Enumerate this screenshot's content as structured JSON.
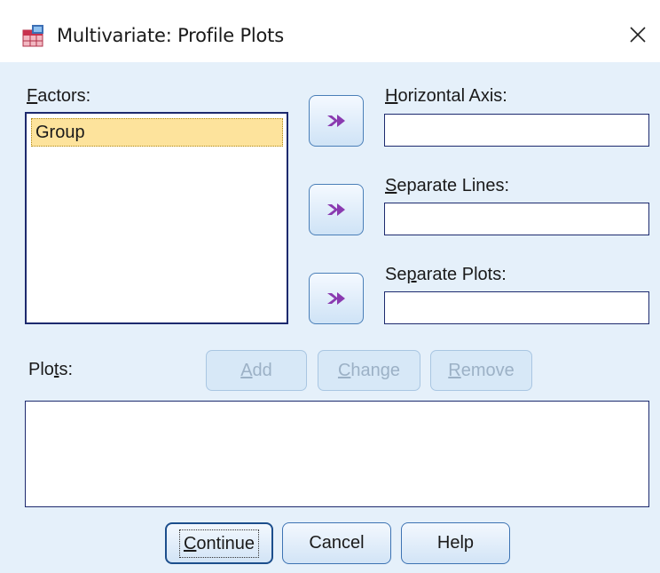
{
  "window": {
    "title": "Multivariate: Profile Plots",
    "app_icon": "spss-dialog-icon",
    "close_icon": "close-icon"
  },
  "factors": {
    "label_mnemonic": "F",
    "label_rest": "actors:",
    "items": [
      "Group"
    ],
    "selected_index": 0
  },
  "move_buttons": {
    "icon": "right-arrow-icon"
  },
  "horizontal_axis": {
    "label_mnemonic": "H",
    "label_rest": "orizontal Axis:",
    "value": ""
  },
  "separate_lines": {
    "label_mnemonic": "S",
    "label_rest": "eparate Lines:",
    "value": ""
  },
  "separate_plots": {
    "label_pre": "Se",
    "label_mnemonic": "p",
    "label_rest": "arate Plots:",
    "value": ""
  },
  "plots": {
    "label_pre": "Plo",
    "label_mnemonic": "t",
    "label_rest": "s:",
    "items": []
  },
  "plot_buttons": {
    "add_mnemonic": "A",
    "add_rest": "dd",
    "change_mnemonic": "C",
    "change_rest": "hange",
    "remove_mnemonic": "R",
    "remove_rest": "emove",
    "enabled": false
  },
  "footer": {
    "continue_mnemonic": "C",
    "continue_rest": "ontinue",
    "cancel": "Cancel",
    "help": "Help"
  },
  "colors": {
    "client_bg": "#e5f0fa",
    "selection": "#fde39c",
    "border": "#1d2a6e",
    "arrow": "#8a3ab0"
  }
}
